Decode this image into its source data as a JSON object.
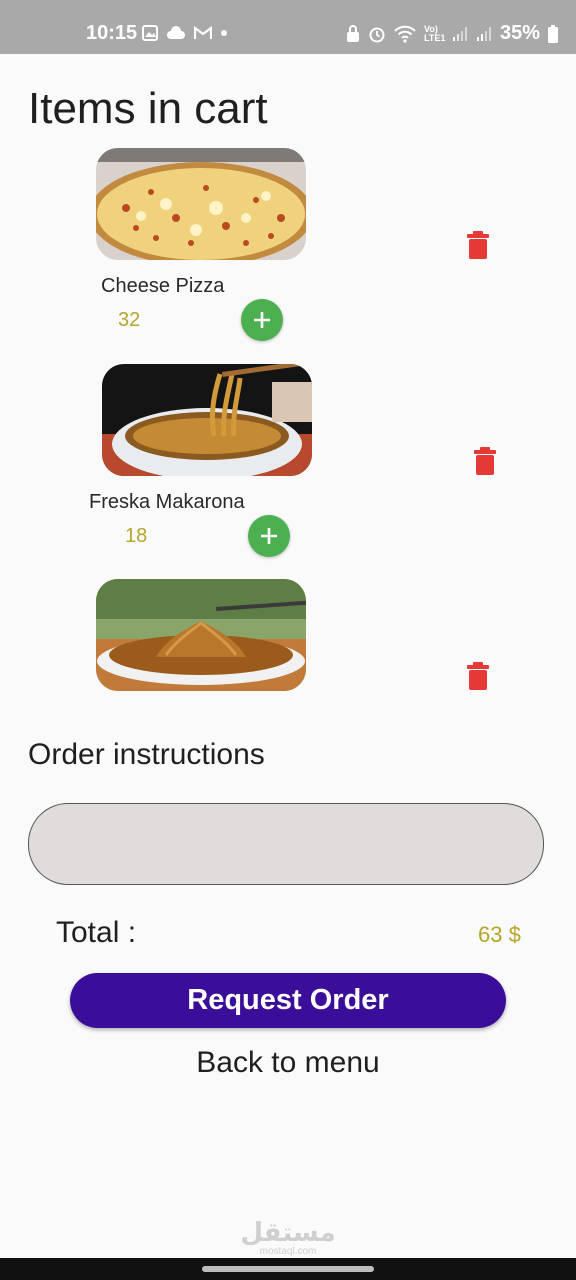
{
  "status_bar": {
    "time": "10:15",
    "battery": "35%",
    "left_icons": [
      "gallery-icon",
      "cloud-icon",
      "gmail-icon",
      "dot-icon"
    ],
    "right_icons": [
      "lock-icon",
      "alarm-icon",
      "wifi-icon",
      "volte-icon",
      "signal-icon",
      "signal-icon",
      "battery-icon"
    ],
    "network_label": "Vo) LTE1"
  },
  "page": {
    "title": "Items in cart"
  },
  "cart": {
    "items": [
      {
        "name": "Cheese Pizza",
        "price": "32",
        "image": "pizza-image"
      },
      {
        "name": "Freska Makarona",
        "price": "18",
        "image": "noodles-bowl-image"
      },
      {
        "name": "",
        "price": "",
        "image": "noodles-plate-image"
      }
    ],
    "add_symbol": "+",
    "delete_icon": "trash-icon"
  },
  "instructions": {
    "label": "Order instructions",
    "value": "",
    "placeholder": ""
  },
  "total": {
    "label": "Total :",
    "value": "63 $"
  },
  "actions": {
    "request_label": "Request Order",
    "back_label": "Back to menu"
  },
  "watermark": {
    "arabic": "مستقل",
    "latin": "mostaql.com"
  },
  "colors": {
    "accent": "#3b0e9a",
    "add": "#4caf50",
    "delete": "#e53935",
    "price": "#b5a52a",
    "status_bar": "#a9a9a9"
  }
}
